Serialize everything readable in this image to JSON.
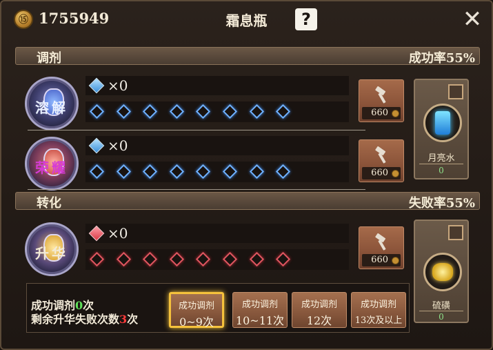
{
  "header": {
    "currency_icon": "coin-icon",
    "currency_glyph": "⑮",
    "gold": "1755949",
    "title": "霜息瓶",
    "help_glyph": "?",
    "close_glyph": "✕"
  },
  "mix_section": {
    "label": "调剂",
    "rate_text": "成功率55%"
  },
  "transform_section": {
    "label": "转化",
    "rate_text": "失败率55%"
  },
  "rows": [
    {
      "potion_label": "溶解",
      "gem_count": "×0",
      "price": "660"
    },
    {
      "potion_label": "荣耀",
      "gem_count": "×0",
      "price": "660"
    },
    {
      "potion_label": "升华",
      "gem_count": "×0",
      "price": "660"
    }
  ],
  "materials": [
    {
      "name": "月亮水",
      "qty": "0"
    },
    {
      "name": "硫磺",
      "qty": "0"
    }
  ],
  "info": {
    "line1_prefix": "成功调剂",
    "line1_value": "0",
    "line1_suffix": "次",
    "line2_prefix": "剩余升华失败次数",
    "line2_value": "3",
    "line2_suffix": "次"
  },
  "tiers": [
    {
      "top": "成功调剂",
      "bottom": "0~9次",
      "selected": true
    },
    {
      "top": "成功调剂",
      "bottom": "10~11次",
      "selected": false
    },
    {
      "top": "成功调剂",
      "bottom": "12次",
      "selected": false
    },
    {
      "top": "成功调剂",
      "bottom": "13次及以上",
      "selected": false
    }
  ],
  "colors": {
    "success_green": "#5fe05a",
    "warning_red": "#ff3b3b",
    "gem_blue": "#6fb1ff",
    "gem_red": "#e05660"
  }
}
